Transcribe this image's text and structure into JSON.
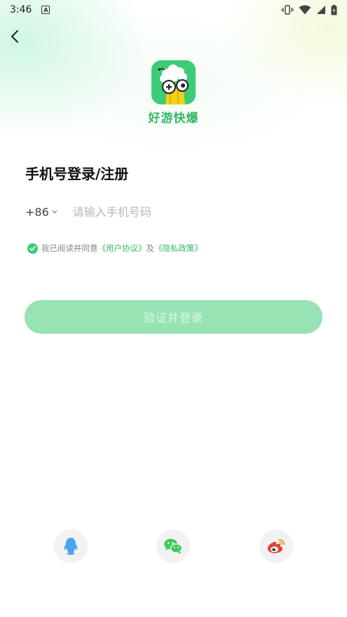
{
  "status_bar": {
    "time": "3:46",
    "notification_letter": "A"
  },
  "app": {
    "name": "好游快爆"
  },
  "page": {
    "title": "手机号登录/注册",
    "country_code": "+86",
    "phone_placeholder": "请输入手机号码",
    "phone_value": ""
  },
  "agreement": {
    "prefix": "我已阅读并同意",
    "user_agreement": "《用户协议》",
    "conjunction": "及",
    "privacy_policy": "《隐私政策》",
    "checked": true
  },
  "login_button": {
    "label": "验证并登录"
  },
  "social_logins": [
    {
      "name": "qq",
      "icon": "qq-penguin-icon",
      "color": "#4aa3f0"
    },
    {
      "name": "wechat",
      "icon": "wechat-icon",
      "color": "#3ecb5a"
    },
    {
      "name": "weibo",
      "icon": "weibo-icon",
      "color": "#e0433b"
    }
  ],
  "colors": {
    "accent": "#3ecb76",
    "button_disabled": "#98e3b4",
    "link": "#35b866"
  }
}
